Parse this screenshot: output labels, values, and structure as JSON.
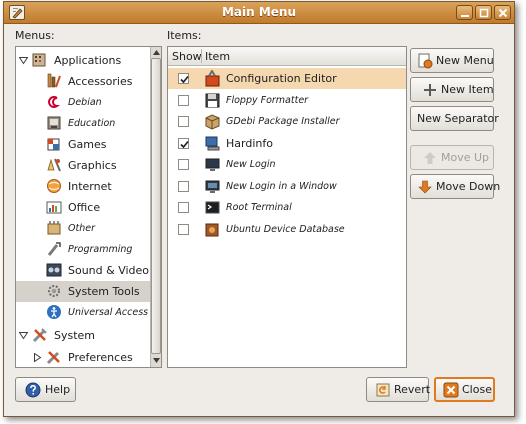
{
  "window": {
    "title": "Main Menu",
    "controls": [
      "minimize-icon",
      "maximize-icon",
      "close-icon"
    ]
  },
  "menus_label": "Menus:",
  "items_label": "Items:",
  "tree": [
    {
      "label": "Applications",
      "icon": "applications-icon",
      "italic": false,
      "expanded": true
    },
    {
      "label": "Accessories",
      "icon": "accessories-icon",
      "italic": false
    },
    {
      "label": "Debian",
      "icon": "debian-icon",
      "italic": true
    },
    {
      "label": "Education",
      "icon": "education-icon",
      "italic": true
    },
    {
      "label": "Games",
      "icon": "games-icon",
      "italic": false
    },
    {
      "label": "Graphics",
      "icon": "graphics-icon",
      "italic": false
    },
    {
      "label": "Internet",
      "icon": "internet-icon",
      "italic": false
    },
    {
      "label": "Office",
      "icon": "office-icon",
      "italic": false
    },
    {
      "label": "Other",
      "icon": "other-icon",
      "italic": true
    },
    {
      "label": "Programming",
      "icon": "programming-icon",
      "italic": true
    },
    {
      "label": "Sound & Video",
      "icon": "sound-video-icon",
      "italic": false
    },
    {
      "label": "System Tools",
      "icon": "system-tools-icon",
      "italic": false,
      "selected": true
    },
    {
      "label": "Universal Access",
      "icon": "universal-access-icon",
      "italic": true
    },
    {
      "label": "System",
      "icon": "system-icon",
      "italic": false,
      "expanded": true
    },
    {
      "label": "Preferences",
      "icon": "preferences-icon",
      "italic": false,
      "collapsed": true
    }
  ],
  "items_table": {
    "columns": [
      "Show",
      "Item"
    ],
    "rows": [
      {
        "label": "Configuration Editor",
        "checked": true,
        "italic": false,
        "selected": true,
        "icon": "configuration-editor-icon"
      },
      {
        "label": "Floppy Formatter",
        "checked": false,
        "italic": true,
        "icon": "floppy-icon"
      },
      {
        "label": "GDebi Package Installer",
        "checked": false,
        "italic": true,
        "icon": "package-icon"
      },
      {
        "label": "Hardinfo",
        "checked": true,
        "italic": false,
        "icon": "hardinfo-icon"
      },
      {
        "label": "New Login",
        "checked": false,
        "italic": true,
        "icon": "login-icon"
      },
      {
        "label": "New Login in a Window",
        "checked": false,
        "italic": true,
        "icon": "login-window-icon"
      },
      {
        "label": "Root Terminal",
        "checked": false,
        "italic": true,
        "icon": "terminal-icon"
      },
      {
        "label": "Ubuntu Device Database",
        "checked": false,
        "italic": true,
        "icon": "device-database-icon"
      }
    ]
  },
  "buttons": {
    "new_menu": "New Menu",
    "new_item": "New Item",
    "new_separator": "New Separator",
    "move_up": "Move Up",
    "move_down": "Move Down",
    "help": "Help",
    "revert": "Revert",
    "close": "Close"
  },
  "colors": {
    "titlebar": "#c98a3a",
    "selection_items": "#f6d8b0",
    "selection_tree": "#d6d1ca",
    "focus_border": "#e07a1e"
  }
}
